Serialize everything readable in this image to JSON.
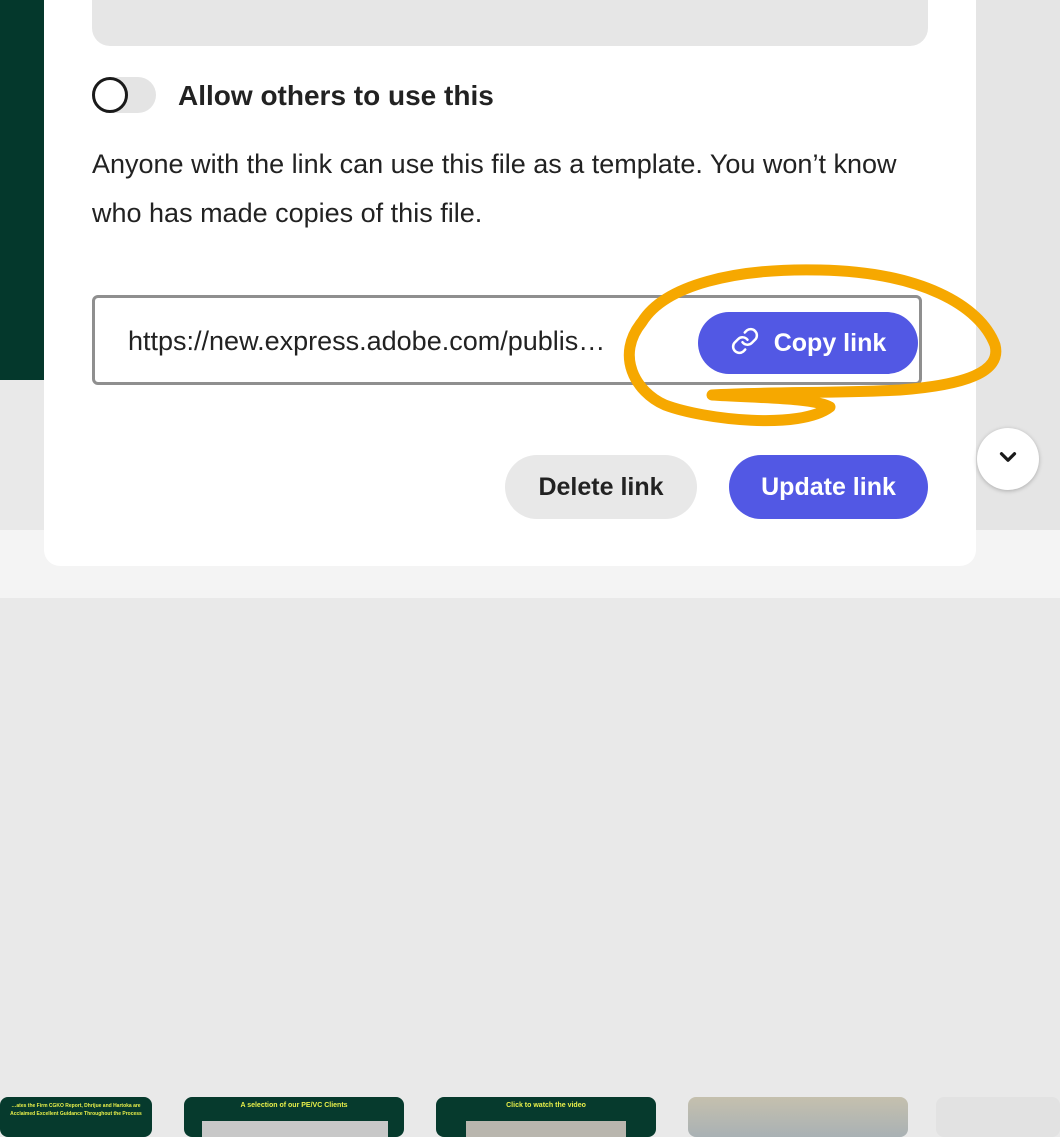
{
  "sharing": {
    "toggle_label": "Allow others to use this",
    "toggle_checked": false,
    "description": "Anyone with the link can use this file as a template. You won’t know who has made copies of this file.",
    "link_url": "https://new.express.adobe.com/publis…",
    "copy_label": "Copy link",
    "delete_label": "Delete link",
    "update_label": "Update link"
  },
  "colors": {
    "accent": "#5258e4",
    "annotation": "#f6a800",
    "brand_green": "#04382c"
  },
  "icons": {
    "copy": "link-icon",
    "scroll": "chevron-down-icon"
  },
  "thumbnails": [
    {
      "caption": "…ates the Firm CGKO Report, Dhrijue and Hartoka are Acclaimed Excellent Guidance Throughout the Process"
    },
    {
      "caption": "A selection of our PE/VC Clients"
    },
    {
      "caption": "Click to watch the video"
    },
    {
      "caption": ""
    },
    {
      "caption": ""
    }
  ]
}
